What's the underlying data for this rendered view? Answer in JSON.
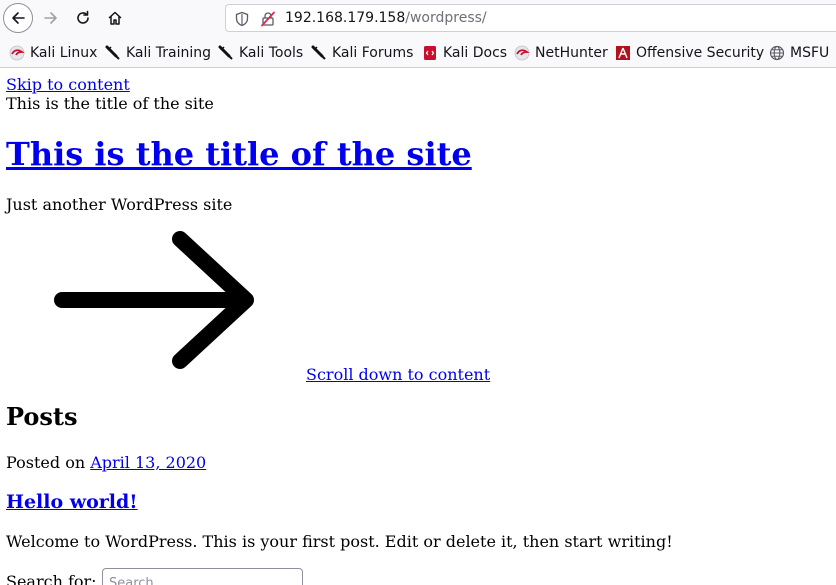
{
  "browser": {
    "url_host": "192.168.179.158",
    "url_path": "/wordpress/",
    "bookmarks": [
      {
        "label": "Kali Linux",
        "icon": "kali-dragon-icon"
      },
      {
        "label": "Kali Training",
        "icon": "kali-knife-icon"
      },
      {
        "label": "Kali Tools",
        "icon": "kali-knife-icon"
      },
      {
        "label": "Kali Forums",
        "icon": "kali-knife-icon"
      },
      {
        "label": "Kali Docs",
        "icon": "kali-docs-icon"
      },
      {
        "label": "NetHunter",
        "icon": "kali-dragon-icon"
      },
      {
        "label": "Offensive Security",
        "icon": "offsec-icon"
      },
      {
        "label": "MSFU",
        "icon": "globe-icon"
      }
    ]
  },
  "page": {
    "skip_link": "Skip to content",
    "site_title_small": "This is the title of the site",
    "site_title": "This is the title of the site",
    "tagline": "Just another WordPress site",
    "scroll_link": "Scroll down to content",
    "posts_heading": "Posts",
    "posted_on": "Posted on",
    "post_date": "April 13, 2020",
    "post_title": "Hello world!",
    "post_excerpt": "Welcome to WordPress. This is your first post. Edit or delete it, then start writing!",
    "search_label": "Search for:",
    "search_placeholder": "Search …"
  },
  "colors": {
    "link": "#0000ee",
    "chrome_bg": "#f9f9fb"
  }
}
